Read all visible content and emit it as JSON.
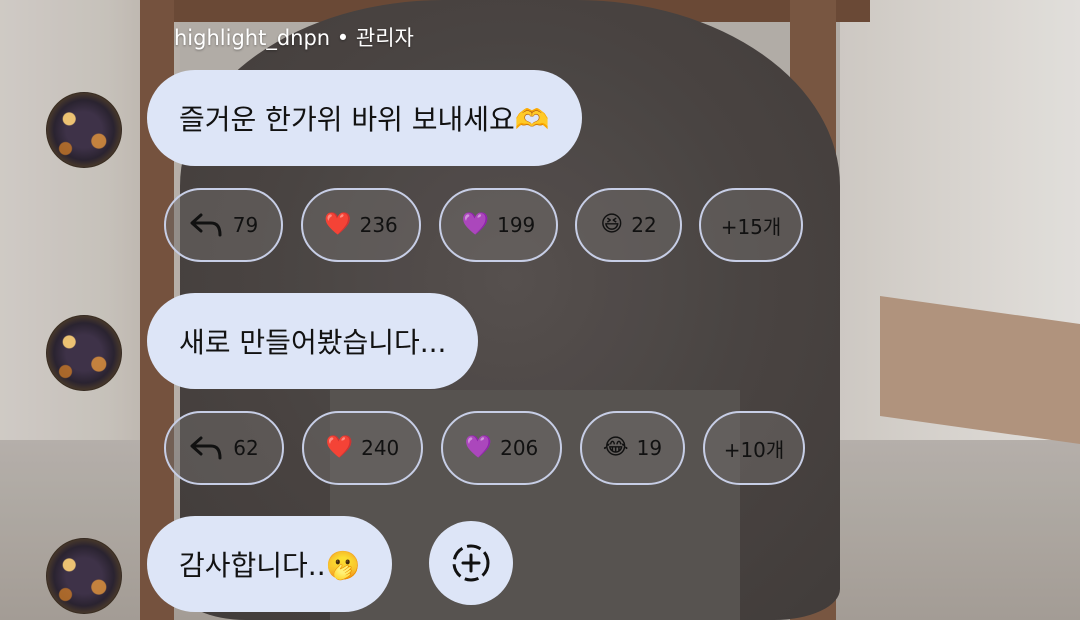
{
  "message_header": {
    "username": "highlight_dnpn",
    "separator": "•",
    "role": "관리자"
  },
  "messages": [
    {
      "text": "즐거운 한가위 바위 보내세요🫶",
      "reactions": [
        {
          "type": "reply",
          "icon": "reply-arrow-icon",
          "count": "79"
        },
        {
          "type": "emoji",
          "emoji": "❤️",
          "icon": "red-heart-icon",
          "count": "236"
        },
        {
          "type": "emoji",
          "emoji": "💜",
          "icon": "purple-heart-icon",
          "count": "199"
        },
        {
          "type": "emoji",
          "emoji": "😆",
          "icon": "grinning-squinting-face-icon",
          "count": "22"
        },
        {
          "type": "more",
          "label": "+15개"
        }
      ]
    },
    {
      "text": "새로 만들어봤습니다...",
      "reactions": [
        {
          "type": "reply",
          "icon": "reply-arrow-icon",
          "count": "62"
        },
        {
          "type": "emoji",
          "emoji": "❤️",
          "icon": "red-heart-icon",
          "count": "240"
        },
        {
          "type": "emoji",
          "emoji": "💜",
          "icon": "purple-heart-icon",
          "count": "206"
        },
        {
          "type": "emoji",
          "emoji": "😂",
          "icon": "tears-of-joy-face-icon",
          "count": "19"
        },
        {
          "type": "more",
          "label": "+10개"
        }
      ]
    },
    {
      "text": "감사합니다..🫢"
    }
  ],
  "add_reaction": {
    "icon": "add-reaction-icon"
  },
  "colors": {
    "bubble": "#dde5f7",
    "chip_border": "#c7cee6",
    "username": "#ffffff"
  }
}
